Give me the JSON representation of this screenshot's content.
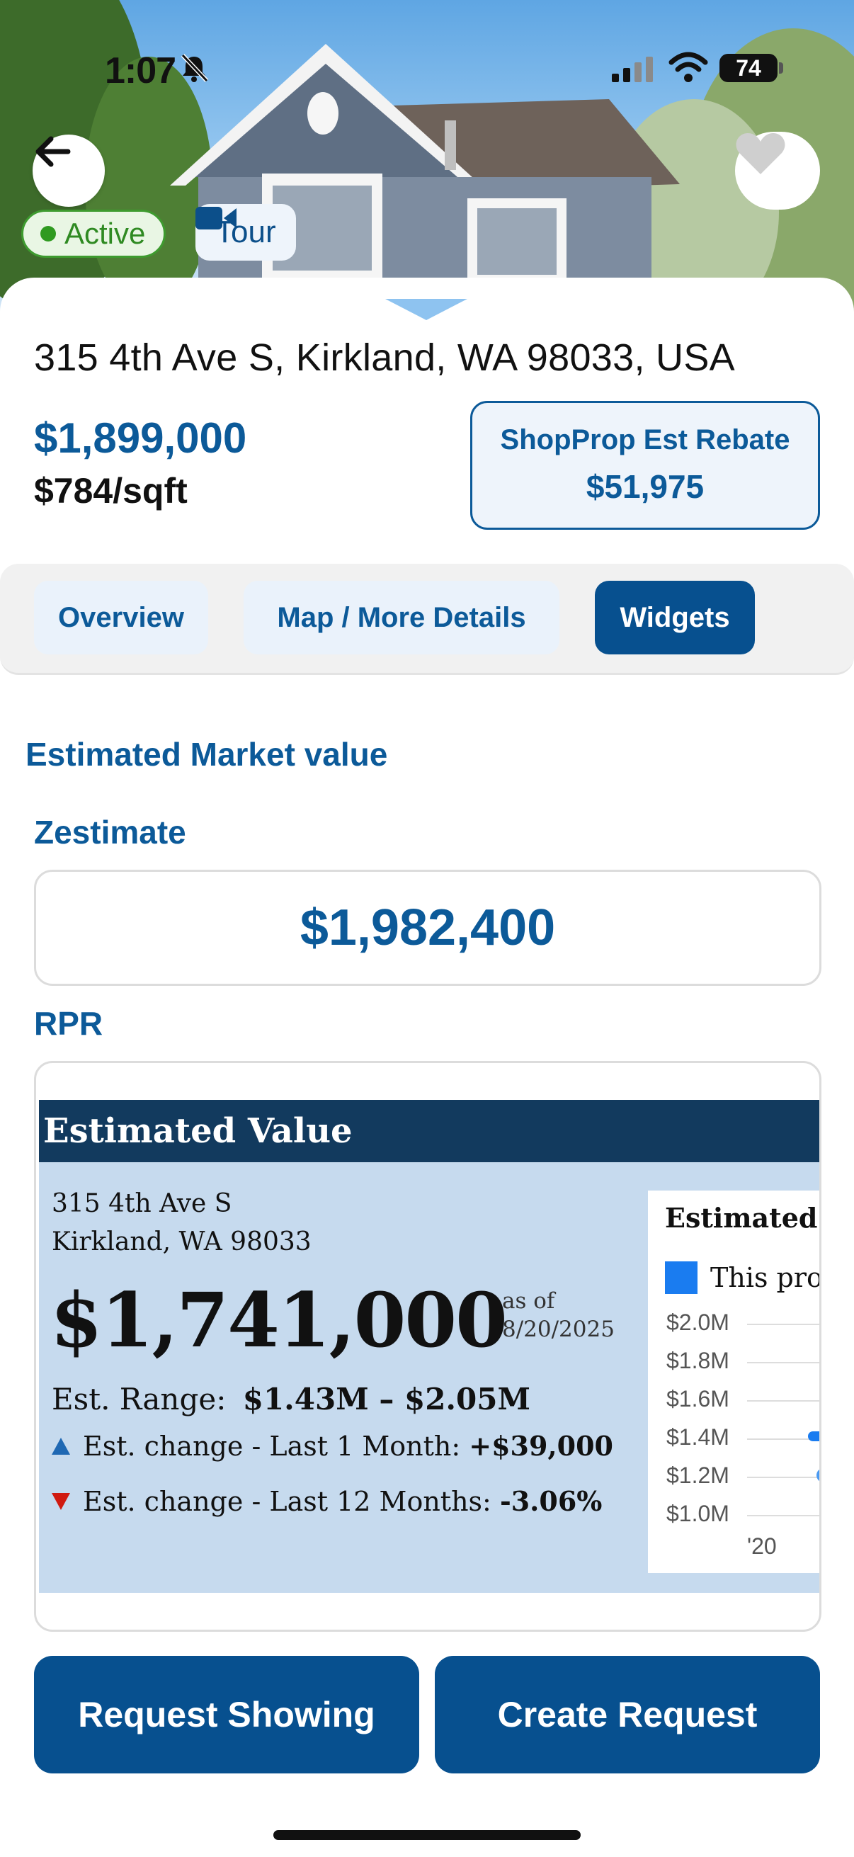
{
  "status_bar": {
    "time": "1:07",
    "battery": "74"
  },
  "listing": {
    "status": "Active",
    "tour_label": "Tour",
    "address": "315 4th Ave S, Kirkland, WA 98033, USA",
    "price": "$1,899,000",
    "price_per_sqft": "$784/sqft",
    "rebate_label": "ShopProp Est Rebate",
    "rebate_value": "$51,975"
  },
  "tabs": [
    {
      "label": "Overview",
      "active": false
    },
    {
      "label": "Map / More Details",
      "active": false
    },
    {
      "label": "Widgets",
      "active": true
    }
  ],
  "market_value": {
    "section_title": "Estimated Market value",
    "zestimate_label": "Zestimate",
    "zestimate_value": "$1,982,400",
    "rpr_label": "RPR"
  },
  "rpr": {
    "header": "Estimated Value",
    "address_line1": "315 4th Ave S",
    "address_line2": "Kirkland, WA 98033",
    "value": "$1,741,000",
    "as_of_label": "as of",
    "as_of_date": "8/20/2025",
    "range_label": "Est. Range:",
    "range_value": "$1.43M – $2.05M",
    "change_1m_label": "Est. change - Last 1 Month:",
    "change_1m_value": "+$39,000",
    "change_12m_label": "Est. change - Last 12 Months:",
    "change_12m_value": "-3.06%",
    "chart_title": "Estimated V",
    "chart_legend": "This prop",
    "chart_ticks": [
      "$2.0M",
      "$1.8M",
      "$1.6M",
      "$1.4M",
      "$1.2M",
      "$1.0M"
    ],
    "chart_x_tick": "'20"
  },
  "actions": {
    "request_showing": "Request Showing",
    "create_request": "Create Request"
  },
  "colors": {
    "brand_blue": "#07508f",
    "active_green": "#2f8a22",
    "rpr_navy": "#123a5e",
    "rpr_panel": "#c6daee"
  }
}
